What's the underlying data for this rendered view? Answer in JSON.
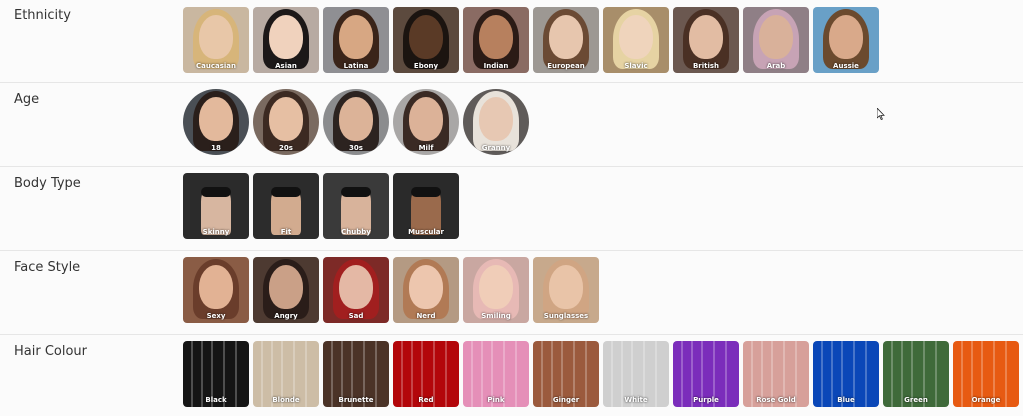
{
  "sections": [
    {
      "label": "Ethnicity",
      "shape": "square",
      "options": [
        {
          "label": "Caucasian",
          "bg": "#c9b7a0",
          "skin": "#e8c7a8",
          "hair": "#d7b57a"
        },
        {
          "label": "Asian",
          "bg": "#b7aaa2",
          "skin": "#f0d2bd",
          "hair": "#1c1818"
        },
        {
          "label": "Latina",
          "bg": "#8f8f93",
          "skin": "#d7a783",
          "hair": "#3a2419"
        },
        {
          "label": "Ebony",
          "bg": "#5c4a3e",
          "skin": "#5a3a26",
          "hair": "#1b1410"
        },
        {
          "label": "Indian",
          "bg": "#8a6b63",
          "skin": "#b7805e",
          "hair": "#2b1b16"
        },
        {
          "label": "European",
          "bg": "#9d9893",
          "skin": "#e7c6ae",
          "hair": "#6b4a34"
        },
        {
          "label": "Slavic",
          "bg": "#a88e6a",
          "skin": "#efd4bc",
          "hair": "#e6d3a3"
        },
        {
          "label": "British",
          "bg": "#6b5850",
          "skin": "#e2bca3",
          "hair": "#4a3024"
        },
        {
          "label": "Arab",
          "bg": "#8f7f86",
          "skin": "#d9b19a",
          "hair": "#c7a3b5"
        },
        {
          "label": "Aussie",
          "bg": "#69a0c7",
          "skin": "#d9a98a",
          "hair": "#6b4a2e"
        }
      ]
    },
    {
      "label": "Age",
      "shape": "round",
      "options": [
        {
          "label": "18",
          "bg": "#4a4f55",
          "skin": "#e3b99c",
          "hair": "#2a1f1b"
        },
        {
          "label": "20s",
          "bg": "#7a6a60",
          "skin": "#e6bfa3",
          "hair": "#3c2a22"
        },
        {
          "label": "30s",
          "bg": "#8b8c8e",
          "skin": "#dcb398",
          "hair": "#2c2320"
        },
        {
          "label": "Milf",
          "bg": "#a9a7a6",
          "skin": "#dcb298",
          "hair": "#3a2a24"
        },
        {
          "label": "Granny",
          "bg": "#5f5b59",
          "skin": "#e7c8b3",
          "hair": "#e8e2da"
        }
      ]
    },
    {
      "label": "Body Type",
      "shape": "square",
      "options": [
        {
          "label": "Skinny",
          "bg": "#2b2b2b",
          "skin": "#d7b6a0"
        },
        {
          "label": "Fit",
          "bg": "#2c2c2c",
          "skin": "#d2ab8f"
        },
        {
          "label": "Chubby",
          "bg": "#3a3a3a",
          "skin": "#d8b39b"
        },
        {
          "label": "Muscular",
          "bg": "#2a2a2a",
          "skin": "#9a6a4c"
        }
      ]
    },
    {
      "label": "Face Style",
      "shape": "square",
      "options": [
        {
          "label": "Sexy",
          "bg": "#8a5c45",
          "skin": "#e2b294",
          "hair": "#6a3d2b"
        },
        {
          "label": "Angry",
          "bg": "#4d3a31",
          "skin": "#caa087",
          "hair": "#2a1d19"
        },
        {
          "label": "Sad",
          "bg": "#7d2a27",
          "skin": "#e4b8a5",
          "hair": "#a11f1f"
        },
        {
          "label": "Nerd",
          "bg": "#b49a83",
          "skin": "#edc6ae",
          "hair": "#b17a55"
        },
        {
          "label": "Smiling",
          "bg": "#c9a7a1",
          "skin": "#f0cdb8",
          "hair": "#e7b9b5"
        },
        {
          "label": "Sunglasses",
          "bg": "#c7a98c",
          "skin": "#e9c4a8",
          "hair": "#d0a583"
        }
      ]
    },
    {
      "label": "Hair Colour",
      "shape": "square",
      "options": [
        {
          "label": "Black",
          "bg": "#151515"
        },
        {
          "label": "Blonde",
          "bg": "#cdbda6"
        },
        {
          "label": "Brunette",
          "bg": "#4b3327"
        },
        {
          "label": "Red",
          "bg": "#b3060a"
        },
        {
          "label": "Pink",
          "bg": "#e58fb8"
        },
        {
          "label": "Ginger",
          "bg": "#9b5a3d"
        },
        {
          "label": "White",
          "bg": "#cfcfcf"
        },
        {
          "label": "Purple",
          "bg": "#7b2dbb"
        },
        {
          "label": "Rose Gold",
          "bg": "#d7a09a"
        },
        {
          "label": "Blue",
          "bg": "#0a47b8"
        },
        {
          "label": "Green",
          "bg": "#3f6a3a"
        },
        {
          "label": "Orange",
          "bg": "#e75a12"
        }
      ]
    }
  ]
}
